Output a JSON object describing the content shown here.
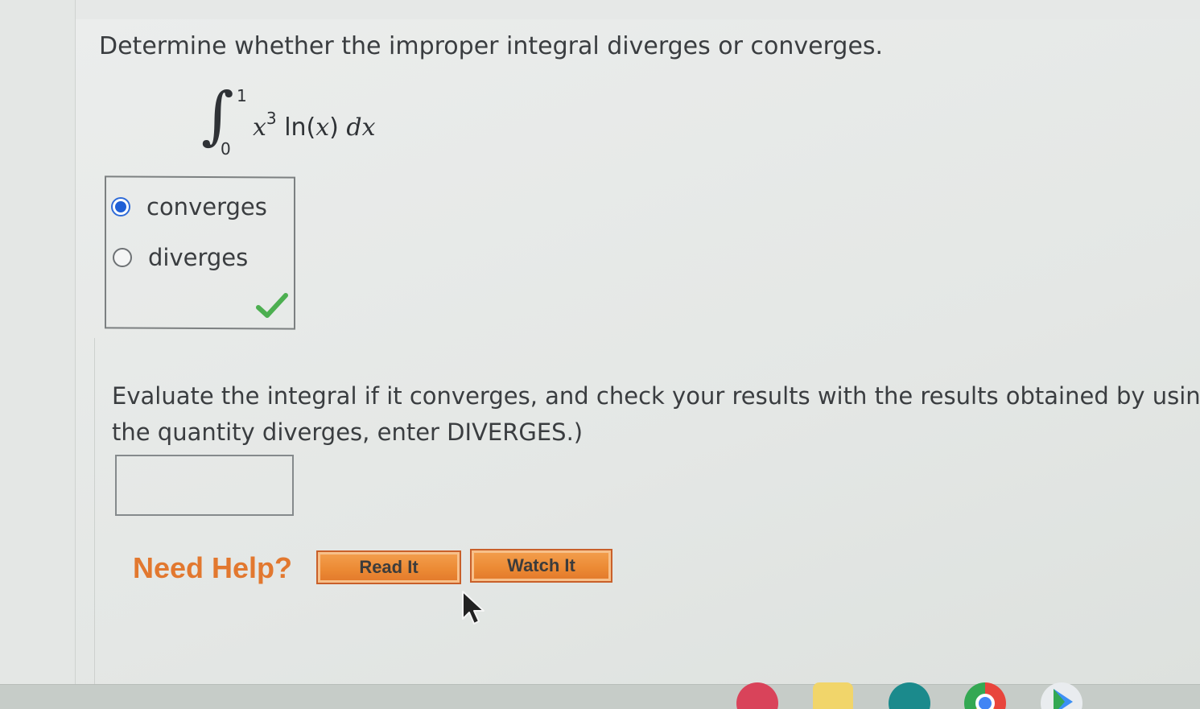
{
  "question": {
    "prompt": "Determine whether the improper integral diverges or converges.",
    "integral": {
      "upper_limit": "1",
      "lower_limit": "0",
      "integrand_base": "x",
      "integrand_exponent": "3",
      "integrand_rest": " ln(",
      "integrand_var": "x",
      "integrand_close": ") ",
      "differential": "dx"
    }
  },
  "choices": {
    "options": [
      {
        "label": "converges",
        "selected": true
      },
      {
        "label": "diverges",
        "selected": false
      }
    ],
    "result_icon": "checkmark-icon",
    "result_color": "#4caf50"
  },
  "evaluate": {
    "line1": "Evaluate the integral if it converges, and check your results with the results obtained by using",
    "line2": "the quantity diverges, enter DIVERGES.)",
    "answer_value": ""
  },
  "help": {
    "title": "Need Help?",
    "read_label": "Read It",
    "watch_label": "Watch It",
    "accent_color": "#e2782f"
  },
  "taskbar": {
    "icons": [
      "apps-icon",
      "classroom-icon",
      "meet-icon",
      "chrome-icon",
      "play-store-icon"
    ]
  }
}
